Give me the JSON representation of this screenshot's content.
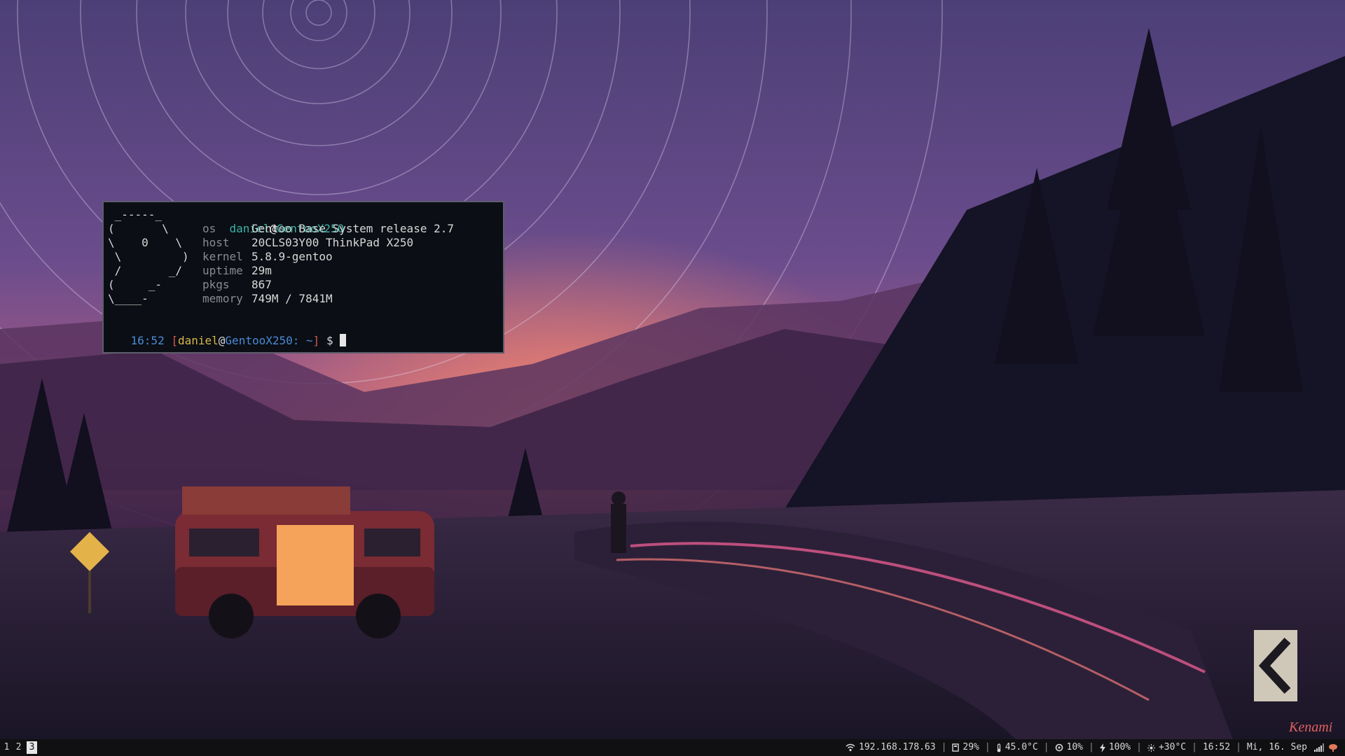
{
  "wallpaper": {
    "signature": "Kenami"
  },
  "terminal": {
    "user": "daniel",
    "at": "@",
    "host": "GentooX250",
    "logo": [
      " _-----_",
      "(       \\",
      "\\    0    \\",
      " \\         )",
      " /       _/",
      "(     _-",
      "\\____-"
    ],
    "fields": [
      {
        "key": "os",
        "value": "Gentoo Base System release 2.7"
      },
      {
        "key": "host",
        "value": "20CLS03Y00 ThinkPad X250"
      },
      {
        "key": "kernel",
        "value": "5.8.9-gentoo"
      },
      {
        "key": "uptime",
        "value": "29m"
      },
      {
        "key": "pkgs",
        "value": "867"
      },
      {
        "key": "memory",
        "value": "749M / 7841M"
      }
    ],
    "prompt": {
      "time": "16:52",
      "open_bracket": "[",
      "user": "daniel",
      "at": "@",
      "host": "GentooX250:",
      "path": " ~",
      "close_bracket": "]",
      "symbol": "$"
    }
  },
  "bar": {
    "workspaces": [
      "1",
      "2",
      "3"
    ],
    "active_workspace": "3",
    "status": {
      "ip": "192.168.178.63",
      "disk": "29%",
      "temp": "45.0°C",
      "cpu": "10%",
      "battery": "100%",
      "weather": "+30°C",
      "time": "16:52",
      "date": "Mi, 16. Sep"
    },
    "separator": "|"
  },
  "colors": {
    "terminal_bg": "#0b0e14",
    "accent_teal": "#3bb5a8",
    "prompt_blue": "#4a8bd6",
    "bracket_red": "#d65a4a",
    "user_yellow": "#d9b84a"
  }
}
